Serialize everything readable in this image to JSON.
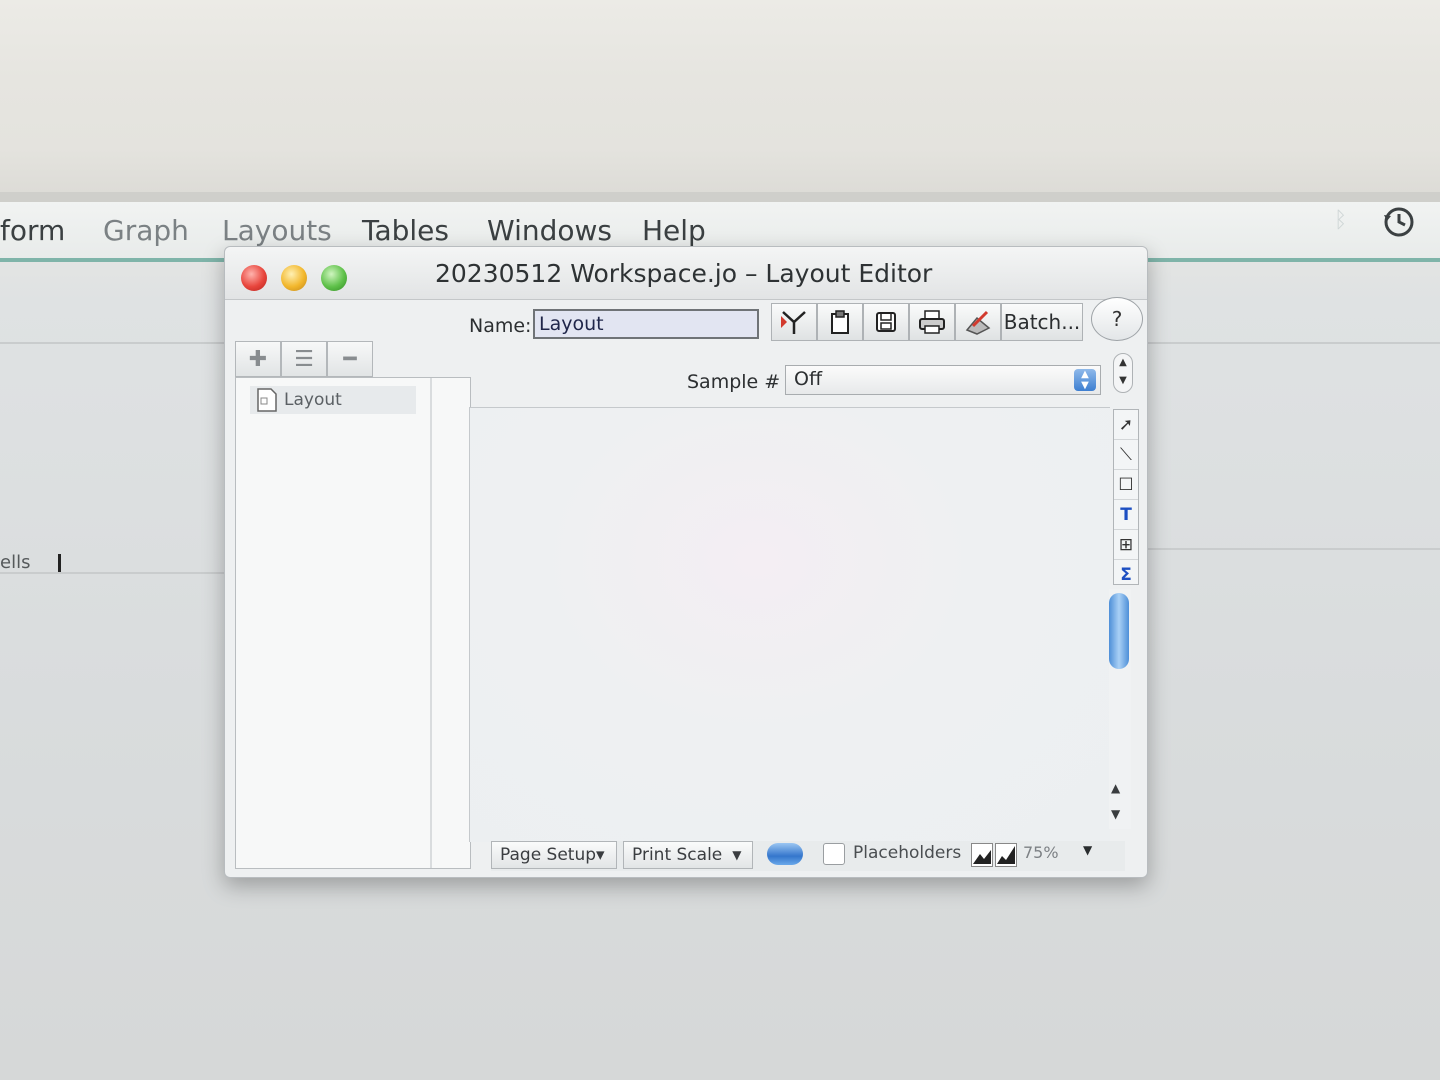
{
  "menubar": {
    "items": [
      "form",
      "Graph",
      "Layouts",
      "Tables",
      "Windows",
      "Help"
    ]
  },
  "background_window": {
    "fragment_label": "ells"
  },
  "window": {
    "title": "20230512 Workspace.jo – Layout Editor",
    "name_label": "Name:",
    "name_value": "Layout",
    "batch_label": "Batch...",
    "help_label": "?",
    "sample_label": "Sample #",
    "sample_value": "Off",
    "list_items": [
      {
        "label": "Layout"
      }
    ],
    "bottom": {
      "page_setup": "Page Setup▾",
      "print_scale": "Print Scale",
      "placeholders": "Placeholders",
      "zoom": "75%"
    }
  },
  "colors": {
    "menubar_accent": "#7fb4a9",
    "scroll_blue": "#4d8fd8",
    "close": "#e8463d",
    "minimize": "#f2b72d",
    "maximize": "#5fc14a"
  },
  "icons": [
    "clock-history-icon",
    "bluetooth-icon",
    "add-icon",
    "list-icon",
    "remove-icon",
    "layout-doc-icon",
    "text-tool-icon",
    "sigma-tool-icon"
  ]
}
